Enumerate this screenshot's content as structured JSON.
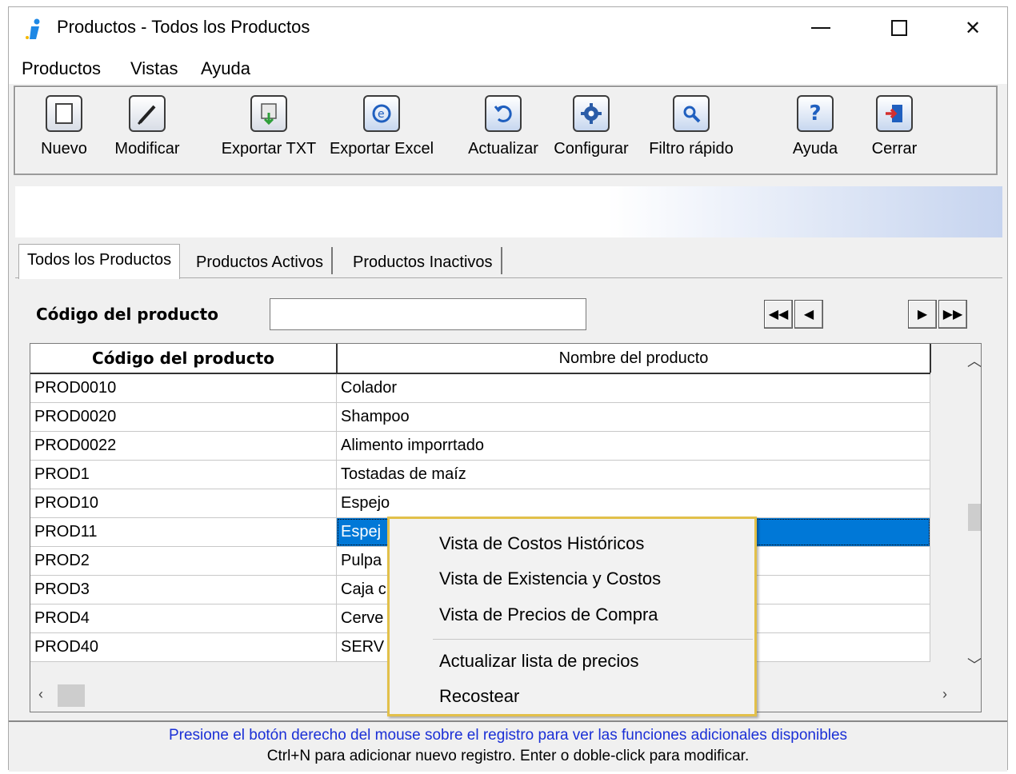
{
  "window": {
    "title": "Productos - Todos los Productos"
  },
  "menubar": {
    "items": [
      "Productos",
      "Vistas",
      "Ayuda"
    ]
  },
  "toolbar": {
    "buttons": [
      {
        "label": "Nuevo",
        "icon": "new-document-icon"
      },
      {
        "label": "Modificar",
        "icon": "pencil-icon"
      },
      {
        "label": "Exportar TXT",
        "icon": "export-txt-icon"
      },
      {
        "label": "Exportar Excel",
        "icon": "export-excel-icon"
      },
      {
        "label": "Actualizar",
        "icon": "refresh-icon"
      },
      {
        "label": "Configurar",
        "icon": "gear-icon"
      },
      {
        "label": "Filtro rápido",
        "icon": "search-filter-icon"
      },
      {
        "label": "Ayuda",
        "icon": "help-icon"
      },
      {
        "label": "Cerrar",
        "icon": "exit-icon"
      }
    ]
  },
  "tabs": [
    "Todos los Productos",
    "Productos Activos",
    "Productos Inactivos"
  ],
  "filter": {
    "label": "Código del producto",
    "value": ""
  },
  "grid": {
    "columns": [
      "Código del producto",
      "Nombre del producto"
    ],
    "rows": [
      {
        "code": "PROD0010",
        "name": "Colador"
      },
      {
        "code": "PROD0020",
        "name": "Shampoo"
      },
      {
        "code": "PROD0022",
        "name": "Alimento imporrtado"
      },
      {
        "code": "PROD1",
        "name": "Tostadas de maíz"
      },
      {
        "code": "PROD10",
        "name": "Espejo"
      },
      {
        "code": "PROD11",
        "name": "Espej"
      },
      {
        "code": "PROD2",
        "name": "Pulpa"
      },
      {
        "code": "PROD3",
        "name": "Caja c"
      },
      {
        "code": "PROD4",
        "name": "Cerve"
      },
      {
        "code": "PROD40",
        "name": "SERV"
      }
    ],
    "selected_row": 5
  },
  "context_menu": {
    "items": [
      "Vista de Costos Históricos",
      "Vista de Existencia y Costos",
      "Vista de Precios de Compra",
      "Actualizar lista de precios",
      "Recostear"
    ]
  },
  "status": {
    "line1": "Presione el botón derecho del mouse sobre el registro para ver las funciones adicionales disponibles",
    "line2": "Ctrl+N para adicionar nuevo registro. Enter o doble-click para modificar."
  },
  "colors": {
    "selection": "#0078d7",
    "status_text": "#1a2fd6",
    "context_border": "#e2c04a"
  }
}
